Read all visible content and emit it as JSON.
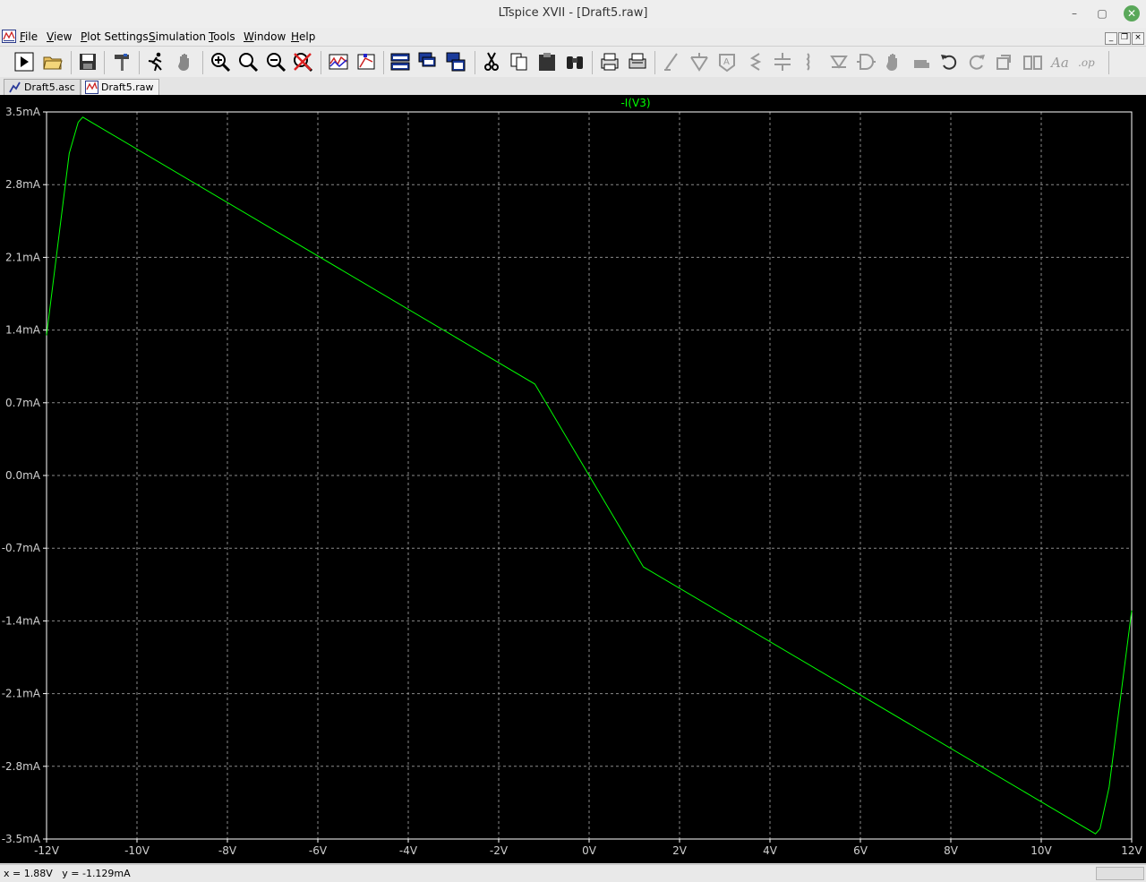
{
  "window": {
    "title": "LTspice XVII - [Draft5.raw]",
    "controls": {
      "minimize": "–",
      "maximize": "▢",
      "close": "✕"
    }
  },
  "menu": [
    "File",
    "View",
    "Plot Settings",
    "Simulation",
    "Tools",
    "Window",
    "Help"
  ],
  "toolbar_icons": [
    "run-icon",
    "open-folder-icon",
    "save-icon",
    "hammer-icon",
    "running-man-icon",
    "halt-hand-icon",
    "zoom-in-icon",
    "zoom-icon",
    "zoom-out-icon",
    "zoom-cancel-icon",
    "autorange-icon",
    "marker-icon",
    "tile-horizontal-icon",
    "cascade-icon",
    "tile-vertical-icon",
    "cut-icon",
    "copy-icon",
    "paste-icon",
    "find-icon",
    "print-preview-icon",
    "print-icon",
    "wire-icon",
    "ground-icon",
    "label-net-icon",
    "resistor-icon",
    "capacitor-icon",
    "inductor-icon",
    "diode-icon",
    "component-icon",
    "move-icon",
    "drag-icon",
    "undo-icon",
    "redo-icon",
    "rotate-icon",
    "mirror-icon",
    "text-icon",
    "spice-directive-icon"
  ],
  "tabs": [
    {
      "label": "Draft5.asc",
      "icon": "schematic-icon",
      "active": false
    },
    {
      "label": "Draft5.raw",
      "icon": "waveform-icon",
      "active": true
    }
  ],
  "status": {
    "x_readout": "x = 1.88V",
    "y_readout": "y = -1.129mA"
  },
  "colors": {
    "trace": "#00ff00",
    "plot_bg": "#000000",
    "grid": "#8a8a8a",
    "frame": "#ffffff"
  },
  "chart_data": {
    "type": "line",
    "title": "",
    "xlabel": "",
    "ylabel": "",
    "xlim": [
      -12,
      12
    ],
    "ylim": [
      -3.5,
      3.5
    ],
    "x_unit": "V",
    "y_unit": "mA",
    "grid": true,
    "x_ticks": [
      "-12V",
      "-10V",
      "-8V",
      "-6V",
      "-4V",
      "-2V",
      "0V",
      "2V",
      "4V",
      "6V",
      "8V",
      "10V",
      "12V"
    ],
    "y_ticks": [
      "3.5mA",
      "2.8mA",
      "2.1mA",
      "1.4mA",
      "0.7mA",
      "0.0mA",
      "-0.7mA",
      "-1.4mA",
      "-2.1mA",
      "-2.8mA",
      "-3.5mA"
    ],
    "series": [
      {
        "name": "-I(V3)",
        "x": [
          -12,
          -11.5,
          -11.3,
          -11.2,
          -1.2,
          1.2,
          11.2,
          11.3,
          11.5,
          12
        ],
        "y": [
          1.35,
          3.1,
          3.4,
          3.45,
          0.88,
          -0.88,
          -3.45,
          -3.4,
          -3.0,
          -1.3
        ]
      }
    ]
  }
}
